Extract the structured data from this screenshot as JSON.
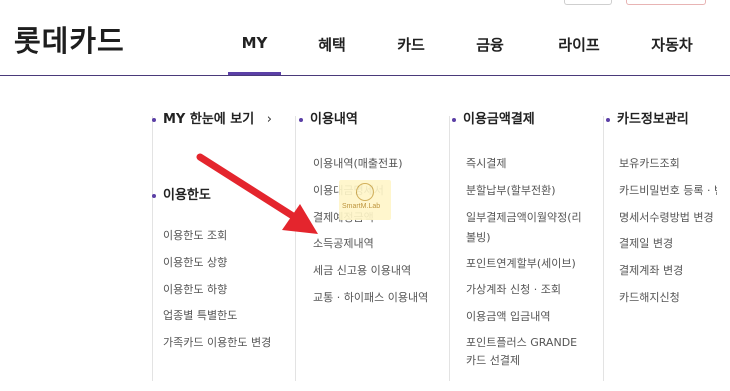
{
  "logo": {
    "text": "롯데카드"
  },
  "gnb": [
    {
      "label": "MY",
      "active": true
    },
    {
      "label": "혜택"
    },
    {
      "label": "카드"
    },
    {
      "label": "금융"
    },
    {
      "label": "라이프"
    },
    {
      "label": "자동차"
    }
  ],
  "columns": {
    "my": {
      "quick_link": "MY 한눈에 보기",
      "limit_heading": "이용한도",
      "limit_items": [
        "이용한도 조회",
        "이용한도 상향",
        "이용한도 하향",
        "업종별 특별한도",
        "가족카드 이용한도 변경"
      ]
    },
    "usage": {
      "heading": "이용내역",
      "items": [
        "이용내역(매출전표)",
        "이용대금명세서",
        "결제예정금액",
        "소득공제내역",
        "세금 신고용 이용내역",
        "교통 · 하이패스 이용내역"
      ]
    },
    "payment": {
      "heading": "이용금액결제",
      "items": [
        "즉시결제",
        "분할납부(할부전환)",
        "일부결제금액이월약정(리볼빙)",
        "포인트연계할부(세이브)",
        "가상계좌 신청 · 조회",
        "이용금액 입금내역",
        "포인트플러스 GRANDE카드 선결제"
      ]
    },
    "cardinfo": {
      "heading": "카드정보관리",
      "items": [
        "보유카드조회",
        "카드비밀번호 등록 · 변",
        "명세서수령방법 변경",
        "결제일 변경",
        "결제계좌 변경",
        "카드해지신청"
      ]
    }
  },
  "watermark": {
    "text": "SmartM.Lab"
  },
  "colors": {
    "accent": "#5b3fa6",
    "arrow": "#e4252d",
    "text": "#555555"
  }
}
